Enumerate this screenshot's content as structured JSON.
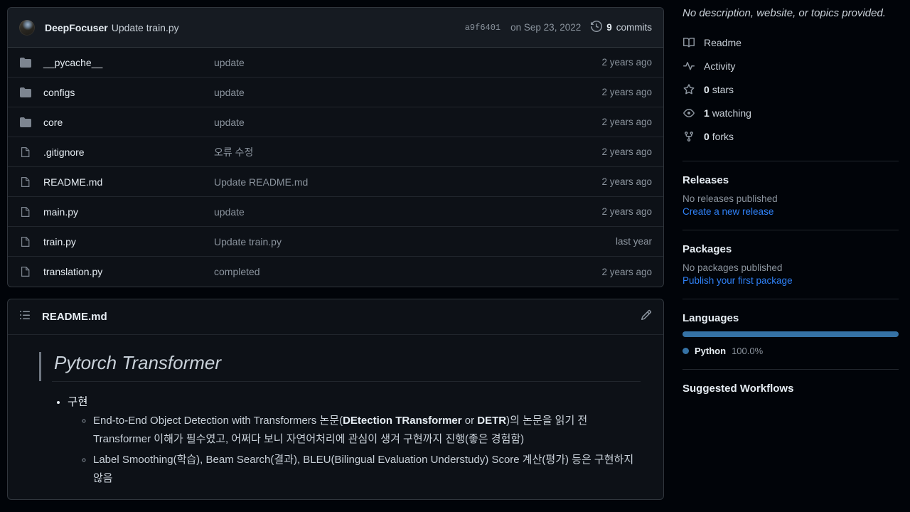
{
  "commit_header": {
    "author": "DeepFocuser",
    "message": "Update train.py",
    "sha": "a9f6401",
    "date": "on Sep 23, 2022",
    "commits_count": "9",
    "commits_label": "commits"
  },
  "files": [
    {
      "type": "folder",
      "name": "__pycache__",
      "message": "update",
      "age": "2 years ago"
    },
    {
      "type": "folder",
      "name": "configs",
      "message": "update",
      "age": "2 years ago"
    },
    {
      "type": "folder",
      "name": "core",
      "message": "update",
      "age": "2 years ago"
    },
    {
      "type": "file",
      "name": ".gitignore",
      "message": "오류 수정",
      "age": "2 years ago"
    },
    {
      "type": "file",
      "name": "README.md",
      "message": "Update README.md",
      "age": "2 years ago"
    },
    {
      "type": "file",
      "name": "main.py",
      "message": "update",
      "age": "2 years ago"
    },
    {
      "type": "file",
      "name": "train.py",
      "message": "Update train.py",
      "age": "last year"
    },
    {
      "type": "file",
      "name": "translation.py",
      "message": "completed",
      "age": "2 years ago"
    }
  ],
  "readme": {
    "title": "README.md",
    "heading": "Pytorch Transformer",
    "bullet1": "구현",
    "sub1": {
      "p1": "End-to-End Object Detection with Transformers 논문(",
      "b1": "DEtection TRansformer",
      "p2": " or ",
      "b2": "DETR",
      "p3": ")의 논문을 읽기 전 Transformer 이해가 필수였고, 어쩌다 보니 자연어처리에 관심이 생겨 구현까지 진행(좋은 경험함)"
    },
    "sub2": "Label Smoothing(학습), Beam Search(결과), BLEU(Bilingual Evaluation Understudy) Score 계산(평가) 등은 구현하지 않음"
  },
  "sidebar": {
    "description": "No description, website, or topics provided.",
    "about_items": [
      {
        "icon": "book-icon",
        "label": "Readme",
        "count": ""
      },
      {
        "icon": "pulse-icon",
        "label": "Activity",
        "count": ""
      },
      {
        "icon": "star-icon",
        "label": "stars",
        "count": "0"
      },
      {
        "icon": "eye-icon",
        "label": "watching",
        "count": "1"
      },
      {
        "icon": "fork-icon",
        "label": "forks",
        "count": "0"
      }
    ],
    "releases": {
      "heading": "Releases",
      "note": "No releases published",
      "link": "Create a new release"
    },
    "packages": {
      "heading": "Packages",
      "note": "No packages published",
      "link": "Publish your first package"
    },
    "languages": {
      "heading": "Languages",
      "items": [
        {
          "name": "Python",
          "percent": "100.0%",
          "value": 100,
          "color": "#3572A5"
        }
      ]
    },
    "workflows": {
      "heading": "Suggested Workflows"
    }
  },
  "colors": {
    "link_blue": "#2f81f7",
    "python_blue": "#3572A5",
    "card_bg": "#0d1117",
    "page_bg": "#010409",
    "border": "#30363d"
  }
}
